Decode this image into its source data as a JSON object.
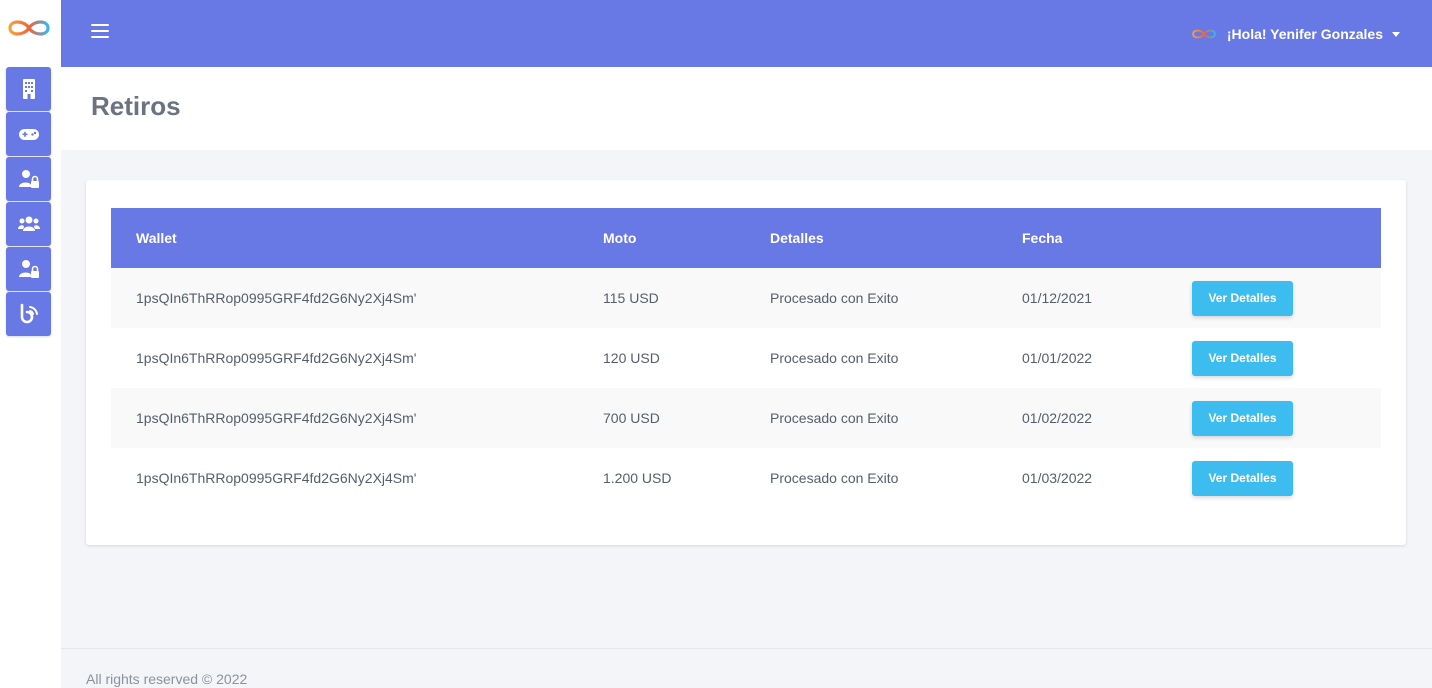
{
  "app": {
    "accent_color": "#6878e4",
    "button_color": "#3dbdef"
  },
  "sidebar": {
    "logo_icon": "infinity-logo",
    "items": [
      {
        "icon": "building-icon"
      },
      {
        "icon": "gamepad-icon"
      },
      {
        "icon": "user-lock-icon"
      },
      {
        "icon": "users-icon"
      },
      {
        "icon": "user-lock-icon"
      },
      {
        "icon": "blog-icon"
      }
    ]
  },
  "topbar": {
    "menu_icon": "hamburger-icon",
    "greeting": "¡Hola! Yenifer Gonzales"
  },
  "page": {
    "title": "Retiros"
  },
  "table": {
    "headers": {
      "wallet": "Wallet",
      "moto": "Moto",
      "detalles": "Detalles",
      "fecha": "Fecha"
    },
    "rows": [
      {
        "wallet": "1psQIn6ThRRop0995GRF4fd2G6Ny2Xj4Sm'",
        "moto": "115 USD",
        "detalles": "Procesado con Exito",
        "fecha": "01/12/2021",
        "action": "Ver Detalles"
      },
      {
        "wallet": "1psQIn6ThRRop0995GRF4fd2G6Ny2Xj4Sm'",
        "moto": "120 USD",
        "detalles": "Procesado con Exito",
        "fecha": "01/01/2022",
        "action": "Ver Detalles"
      },
      {
        "wallet": "1psQIn6ThRRop0995GRF4fd2G6Ny2Xj4Sm'",
        "moto": "700 USD",
        "detalles": "Procesado con Exito",
        "fecha": "01/02/2022",
        "action": "Ver Detalles"
      },
      {
        "wallet": "1psQIn6ThRRop0995GRF4fd2G6Ny2Xj4Sm'",
        "moto": "1.200 USD",
        "detalles": "Procesado con Exito",
        "fecha": "01/03/2022",
        "action": "Ver Detalles"
      }
    ]
  },
  "footer": {
    "text": "All rights reserved © 2022"
  }
}
